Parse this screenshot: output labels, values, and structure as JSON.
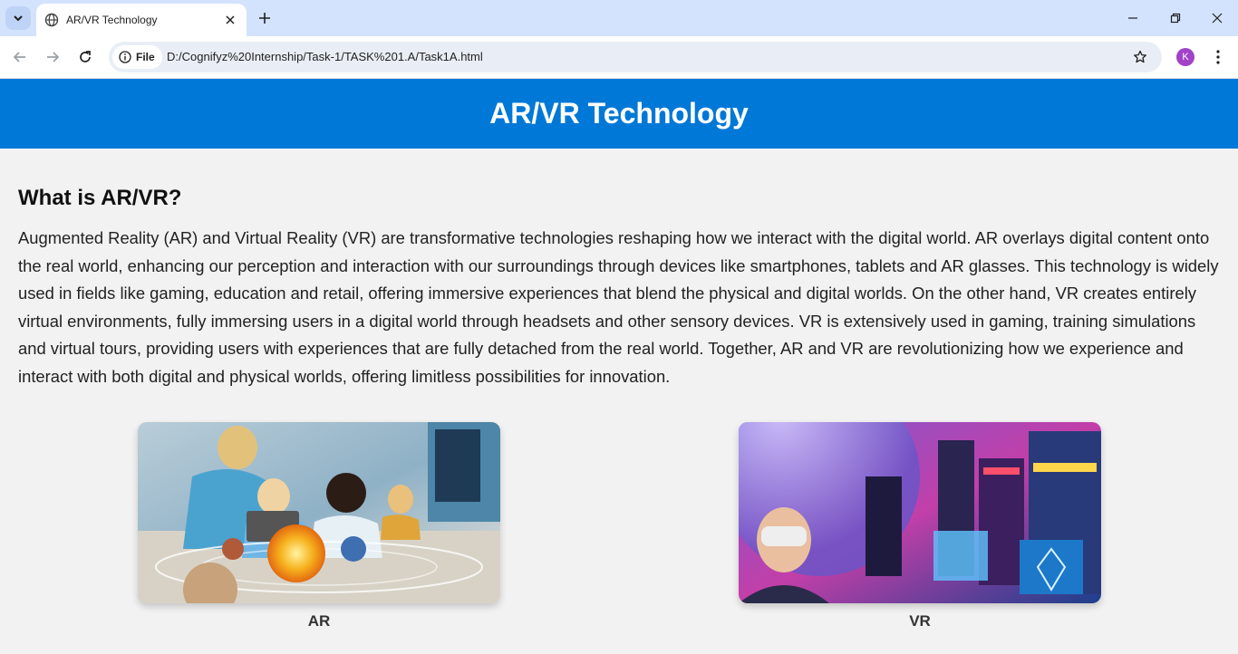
{
  "browser": {
    "tab_title": "AR/VR Technology",
    "chip_label": "File",
    "url": "D:/Cognifyz%20Internship/Task-1/TASK%201.A/Task1A.html",
    "profile_initial": "K"
  },
  "page": {
    "header_title": "AR/VR Technology",
    "section_heading": "What is AR/VR?",
    "paragraph": "Augmented Reality (AR) and Virtual Reality (VR) are transformative technologies reshaping how we interact with the digital world. AR overlays digital content onto the real world, enhancing our perception and interaction with our surroundings through devices like smartphones, tablets and AR glasses. This technology is widely used in fields like gaming, education and retail, offering immersive experiences that blend the physical and digital worlds. On the other hand, VR creates entirely virtual environments, fully immersing users in a digital world through headsets and other sensory devices. VR is extensively used in gaming, training simulations and virtual tours, providing users with experiences that are fully detached from the real world. Together, AR and VR are revolutionizing how we experience and interact with both digital and physical worlds, offering limitless possibilities for innovation.",
    "images": [
      {
        "caption": "AR"
      },
      {
        "caption": "VR"
      }
    ]
  },
  "colors": {
    "header_bg": "#0078d7",
    "page_bg": "#f2f2f2",
    "tabbar_bg": "#d3e3fd",
    "avatar_bg": "#a142c7"
  }
}
